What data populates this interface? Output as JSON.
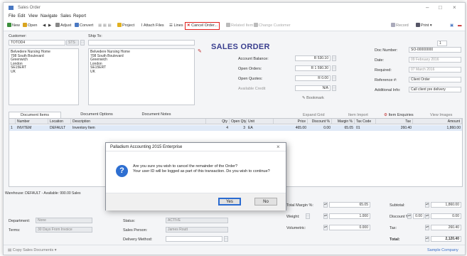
{
  "window": {
    "title": "Sales Order"
  },
  "menu": [
    "File",
    "Edit",
    "View",
    "Navigate",
    "Sales",
    "Report"
  ],
  "toolbar": {
    "new": "New",
    "open": "Open",
    "adjust": "Adjust",
    "convert": "Convert",
    "project": "Project",
    "attach_files": "Attach Files",
    "lines": "Lines",
    "cancel_order": "Cancel Order...",
    "related_item": "Related Item",
    "change_customer": "Change Customer",
    "record": "Record",
    "print": "Print",
    "copies": "1"
  },
  "header": {
    "doc_title": "SALES ORDER"
  },
  "customer": {
    "label": "Customer:",
    "code": "TOTOD4",
    "code_suffix": "STS",
    "ship_to_label": "Ship To:",
    "address": "Belvedere Nursing Home\n708 South Boulevard\nGreenwich\nLondon\nSE15ERT\nUK",
    "ship_address": "Belvedere Nursing Home\n708 South Boulevard\nGreenwich\nLondon\nSE15ERT\nUK"
  },
  "account": {
    "balance_label": "Account Balance:",
    "balance": "R 530.10",
    "open_orders_label": "Open Orders:",
    "open_orders": "R 1 590.30",
    "open_quotes_label": "Open Quotes:",
    "open_quotes": "R 0.00",
    "available_credit_label": "Available Credit",
    "available_credit": "N/A",
    "bookmark": "Bookmark"
  },
  "doc_info": {
    "doc_number_label": "Doc Number:",
    "doc_number": "SO-00000000",
    "date_label": "Date:",
    "date": "09 February 2016",
    "required_label": "Required:",
    "required": "07 March 2016",
    "reference_label": "Reference #:",
    "reference": "Client Order",
    "additional_label": "Additional Info:",
    "additional": "Call client pre delivery"
  },
  "tabs": [
    "Document Items",
    "Document Options",
    "Document Notes"
  ],
  "grid_actions": [
    "Expand Grid",
    "Item Import",
    "Item Enquiries",
    "View Images"
  ],
  "grid": {
    "columns": [
      "Number",
      "Location",
      "Description",
      "Qty",
      "Open Qty",
      "Unit",
      "Price",
      "Discount %",
      "Margin %",
      "Tax Code",
      "Tax",
      "Amount"
    ],
    "rows": [
      [
        "1",
        "INVITEM",
        "DEFAULT",
        "Inventory Item",
        "4",
        "3",
        "EA",
        "465.00",
        "0.00",
        "65.05",
        "01",
        "260.40",
        "1,860.00"
      ]
    ]
  },
  "dialog": {
    "title": "Palladium Accounting 2015 Enterprise",
    "message": "Are you sure you wish to cancel the remainder of the Order?\nYour user ID will be logged as part of this transaction. Do you wish to continue?",
    "yes": "Yes",
    "no": "No"
  },
  "warehouse_text": "Warehouse: DEFAULT - Available: 990.00  Sales",
  "bottom": {
    "department_label": "Department:",
    "department": "None",
    "terms_label": "Terms:",
    "terms": "30 Days From Invoice",
    "status_label": "Status:",
    "status": "ACTIVE",
    "sales_person_label": "Sales Person:",
    "sales_person": "James Routt",
    "delivery_method_label": "Delivery Method:",
    "delivery_method": "",
    "total_margin_label": "Total Margin %:",
    "total_margin": "65.05",
    "weight_label": "Weight:",
    "weight": "1.000",
    "volumetric_label": "Volumetric:",
    "volumetric": "0.000",
    "subtotal_label": "Subtotal:",
    "subtotal": "1,860.00",
    "discount_label": "Discount %:",
    "discount_pct": "0.00",
    "discount_amount": "0.00",
    "tax_label": "Tax:",
    "tax": "260.40",
    "total_label": "Total:",
    "total": "2,120.40"
  },
  "statusbar": {
    "copy_docs": "Copy Sales Documents",
    "company": "Sample Company"
  },
  "colors": {
    "accent": "#3a3f8f",
    "cancel_highlight": "#e0201c",
    "dialog_icon": "#2e6fd1"
  }
}
